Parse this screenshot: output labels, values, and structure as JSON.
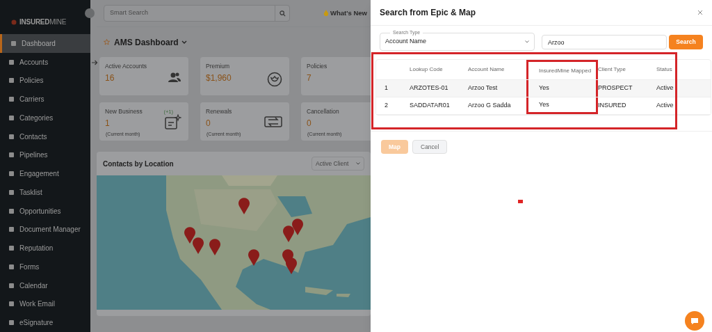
{
  "sidebar": {
    "logo": {
      "strong": "INSURED",
      "light": "MINE"
    },
    "items": [
      {
        "label": "Dashboard",
        "selected": true
      },
      {
        "label": "Accounts",
        "selected": false
      },
      {
        "label": "Policies",
        "selected": false
      },
      {
        "label": "Carriers",
        "selected": false
      },
      {
        "label": "Categories",
        "selected": false
      },
      {
        "label": "Contacts",
        "selected": false
      },
      {
        "label": "Pipelines",
        "selected": false
      },
      {
        "label": "Engagement",
        "selected": false
      },
      {
        "label": "Tasklist",
        "selected": false
      },
      {
        "label": "Opportunities",
        "selected": false
      },
      {
        "label": "Document Manager",
        "selected": false
      },
      {
        "label": "Reputation",
        "selected": false
      },
      {
        "label": "Forms",
        "selected": false
      },
      {
        "label": "Calendar",
        "selected": false
      },
      {
        "label": "Work Email",
        "selected": false
      },
      {
        "label": "eSignature",
        "selected": false
      }
    ]
  },
  "topbar": {
    "search": {
      "placeholder": "Smart Search"
    },
    "whats_new": "What's New"
  },
  "dashboard": {
    "title": "AMS Dashboard",
    "cards": [
      {
        "label": "Active Accounts",
        "value": "16",
        "kind": "people"
      },
      {
        "label": "Premium",
        "value": "$1,960",
        "kind": "badge"
      },
      {
        "label": "Policies",
        "value": "7",
        "kind": "none"
      },
      {
        "label": "New Business",
        "value": "1",
        "note": "(Current month)",
        "delta": "(+1)",
        "kind": "note"
      },
      {
        "label": "Renewals",
        "value": "0",
        "note": "(Current month)",
        "kind": "swap"
      },
      {
        "label": "Cancellation",
        "value": "0",
        "note": "(Current month)",
        "kind": "none"
      }
    ],
    "map_card": {
      "title": "Contacts by Location",
      "filter": "Active Client"
    }
  },
  "modal": {
    "title": "Search from Epic & Map",
    "search_type": {
      "label": "Search Type",
      "value": "Account Name"
    },
    "query": "Arzoo",
    "search_button": "Search",
    "table": {
      "highlighted": true,
      "columns": [
        {
          "highlighted": false
        },
        {
          "label": "Lookup Code",
          "highlighted": false
        },
        {
          "label": "Account Name",
          "highlighted": false
        },
        {
          "label": "InsuredMine Mapped",
          "highlighted": true
        },
        {
          "label": "Client Type",
          "highlighted": false
        },
        {
          "label": "Status",
          "highlighted": false
        }
      ],
      "rows": [
        {
          "selected": true,
          "cells": [
            "1",
            "ARZOTES-01",
            "Arzoo Test",
            "Yes",
            "PROSPECT",
            "Active"
          ]
        },
        {
          "selected": false,
          "cells": [
            "2",
            "SADDATAR01",
            "Arzoo G Sadda",
            "Yes",
            "INSURED",
            "Active"
          ]
        }
      ]
    },
    "buttons": [
      {
        "label": "Map",
        "disabled": true
      },
      {
        "label": "Cancel",
        "disabled": false
      }
    ]
  }
}
